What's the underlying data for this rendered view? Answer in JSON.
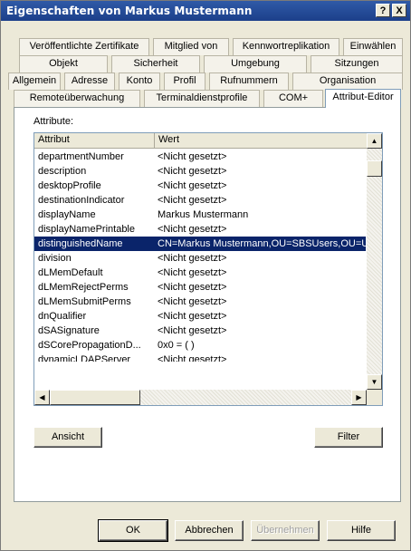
{
  "titlebar": {
    "title": "Eigenschaften von Markus Mustermann",
    "help_glyph": "?",
    "close_glyph": "X"
  },
  "tabs": {
    "row1": [
      "Veröffentlichte Zertifikate",
      "Mitglied von",
      "Kennwortreplikation",
      "Einwählen"
    ],
    "row2": [
      "Objekt",
      "Sicherheit",
      "Umgebung",
      "Sitzungen"
    ],
    "row3": [
      "Allgemein",
      "Adresse",
      "Konto",
      "Profil",
      "Rufnummern",
      "Organisation"
    ],
    "row4": [
      "Remoteüberwachung",
      "Terminaldienstprofile",
      "COM+",
      "Attribut-Editor"
    ],
    "active": "Attribut-Editor"
  },
  "panel": {
    "attributes_label": "Attribute:"
  },
  "list": {
    "columns": [
      "Attribut",
      "Wert"
    ],
    "rows": [
      {
        "attr": "departmentNumber",
        "value": "<Nicht gesetzt>"
      },
      {
        "attr": "description",
        "value": "<Nicht gesetzt>"
      },
      {
        "attr": "desktopProfile",
        "value": "<Nicht gesetzt>"
      },
      {
        "attr": "destinationIndicator",
        "value": "<Nicht gesetzt>"
      },
      {
        "attr": "displayName",
        "value": "Markus Mustermann"
      },
      {
        "attr": "displayNamePrintable",
        "value": "<Nicht gesetzt>"
      },
      {
        "attr": "distinguishedName",
        "value": "CN=Markus Mustermann,OU=SBSUsers,OU=Users,O",
        "selected": true
      },
      {
        "attr": "division",
        "value": "<Nicht gesetzt>"
      },
      {
        "attr": "dLMemDefault",
        "value": "<Nicht gesetzt>"
      },
      {
        "attr": "dLMemRejectPerms",
        "value": "<Nicht gesetzt>"
      },
      {
        "attr": "dLMemSubmitPerms",
        "value": "<Nicht gesetzt>"
      },
      {
        "attr": "dnQualifier",
        "value": "<Nicht gesetzt>"
      },
      {
        "attr": "dSASignature",
        "value": "<Nicht gesetzt>"
      },
      {
        "attr": "dSCorePropagationD...",
        "value": "0x0 = ( )"
      },
      {
        "attr": "dynamicLDAPServer",
        "value": "<Nicht gesetzt>"
      }
    ]
  },
  "panel_buttons": {
    "view": "Ansicht",
    "filter": "Filter"
  },
  "dialog_buttons": {
    "ok": "OK",
    "cancel": "Abbrechen",
    "apply": "Übernehmen",
    "help": "Hilfe"
  },
  "colors": {
    "title_bar": "#1c3f8a",
    "selection": "#0a246a",
    "face": "#ece9d8"
  }
}
